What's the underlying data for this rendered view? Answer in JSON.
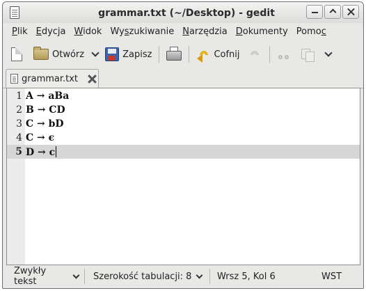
{
  "window": {
    "title": "grammar.txt (~/Desktop) - gedit"
  },
  "menubar": {
    "items": [
      {
        "label": "Plik",
        "mnemonic": "P",
        "rest": "lik"
      },
      {
        "label": "Edycja",
        "mnemonic": "E",
        "rest": "dycja"
      },
      {
        "label": "Widok",
        "mnemonic": "W",
        "rest": "idok"
      },
      {
        "label": "Wyszukiwanie",
        "pre": "Wy",
        "mnemonic": "s",
        "rest": "zukiwanie"
      },
      {
        "label": "Narzędzia",
        "mnemonic": "N",
        "rest": "arzędzia"
      },
      {
        "label": "Dokumenty",
        "mnemonic": "D",
        "rest": "okumenty"
      },
      {
        "label": "Pomoc",
        "pre": "Pomo",
        "mnemonic": "c",
        "rest": ""
      }
    ]
  },
  "toolbar": {
    "open_label": "Otwórz",
    "save_label": "Zapisz",
    "undo_label": "Cofnij"
  },
  "tabs": [
    {
      "label": "grammar.txt"
    }
  ],
  "editor": {
    "current_line": 5,
    "lines": [
      {
        "num": "1",
        "text": "A → aBa"
      },
      {
        "num": "2",
        "text": "B → CD"
      },
      {
        "num": "3",
        "text": "C → bD"
      },
      {
        "num": "4",
        "text": "C → ϵ"
      },
      {
        "num": "5",
        "text": "D → c"
      }
    ]
  },
  "statusbar": {
    "language": "Zwykły tekst",
    "tab_width": "Szerokość tabulacji: 8",
    "position": "Wrsz 5, Kol 6",
    "mode": "WST"
  }
}
